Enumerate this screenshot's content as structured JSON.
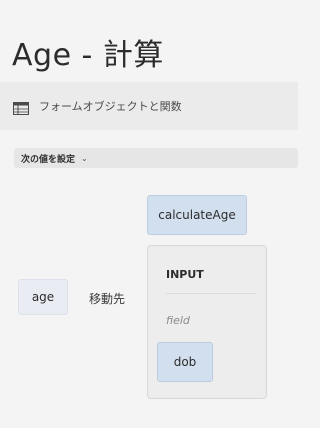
{
  "title": "Age - 計算",
  "objects_panel": {
    "label": "フォームオブジェクトと関数",
    "icon": "table-icon"
  },
  "set_next": {
    "label": "次の値を設定",
    "icon": "chevron-down-icon"
  },
  "rule": {
    "function_name": "calculateAge",
    "target": "age",
    "operator": "移動先",
    "input": {
      "heading": "INPUT",
      "param_label": "field",
      "param_value": "dob"
    }
  }
}
